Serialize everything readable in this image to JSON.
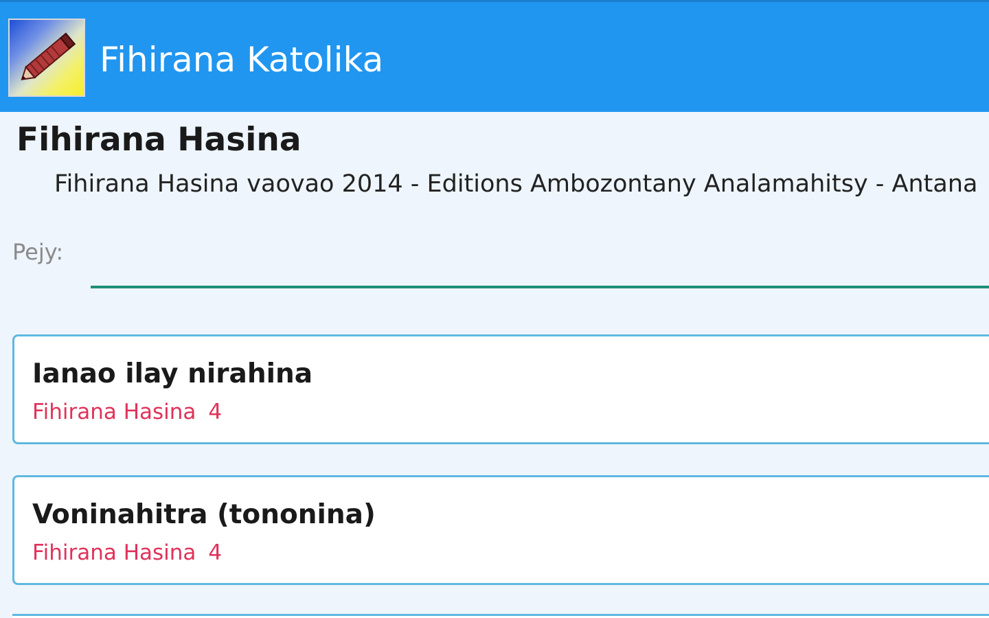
{
  "app_bar": {
    "title": "Fihirana Katolika",
    "icon": "pencil-icon",
    "color": "#2196f0"
  },
  "book": {
    "title": "Fihirana Hasina",
    "subtitle": "Fihirana Hasina vaovao 2014 - Editions Ambozontany Analamahitsy - Antana"
  },
  "page_search": {
    "label": "Pejy:",
    "value": ""
  },
  "songs": [
    {
      "title": "Ianao ilay nirahina",
      "book": "Fihirana Hasina",
      "page": "4"
    },
    {
      "title": "Voninahitra (tononina)",
      "book": "Fihirana Hasina",
      "page": "4"
    }
  ],
  "colors": {
    "accent": "#2196f0",
    "meta_text": "#e0325a",
    "input_underline": "#1e8f78",
    "card_border": "#5fb8e0"
  }
}
